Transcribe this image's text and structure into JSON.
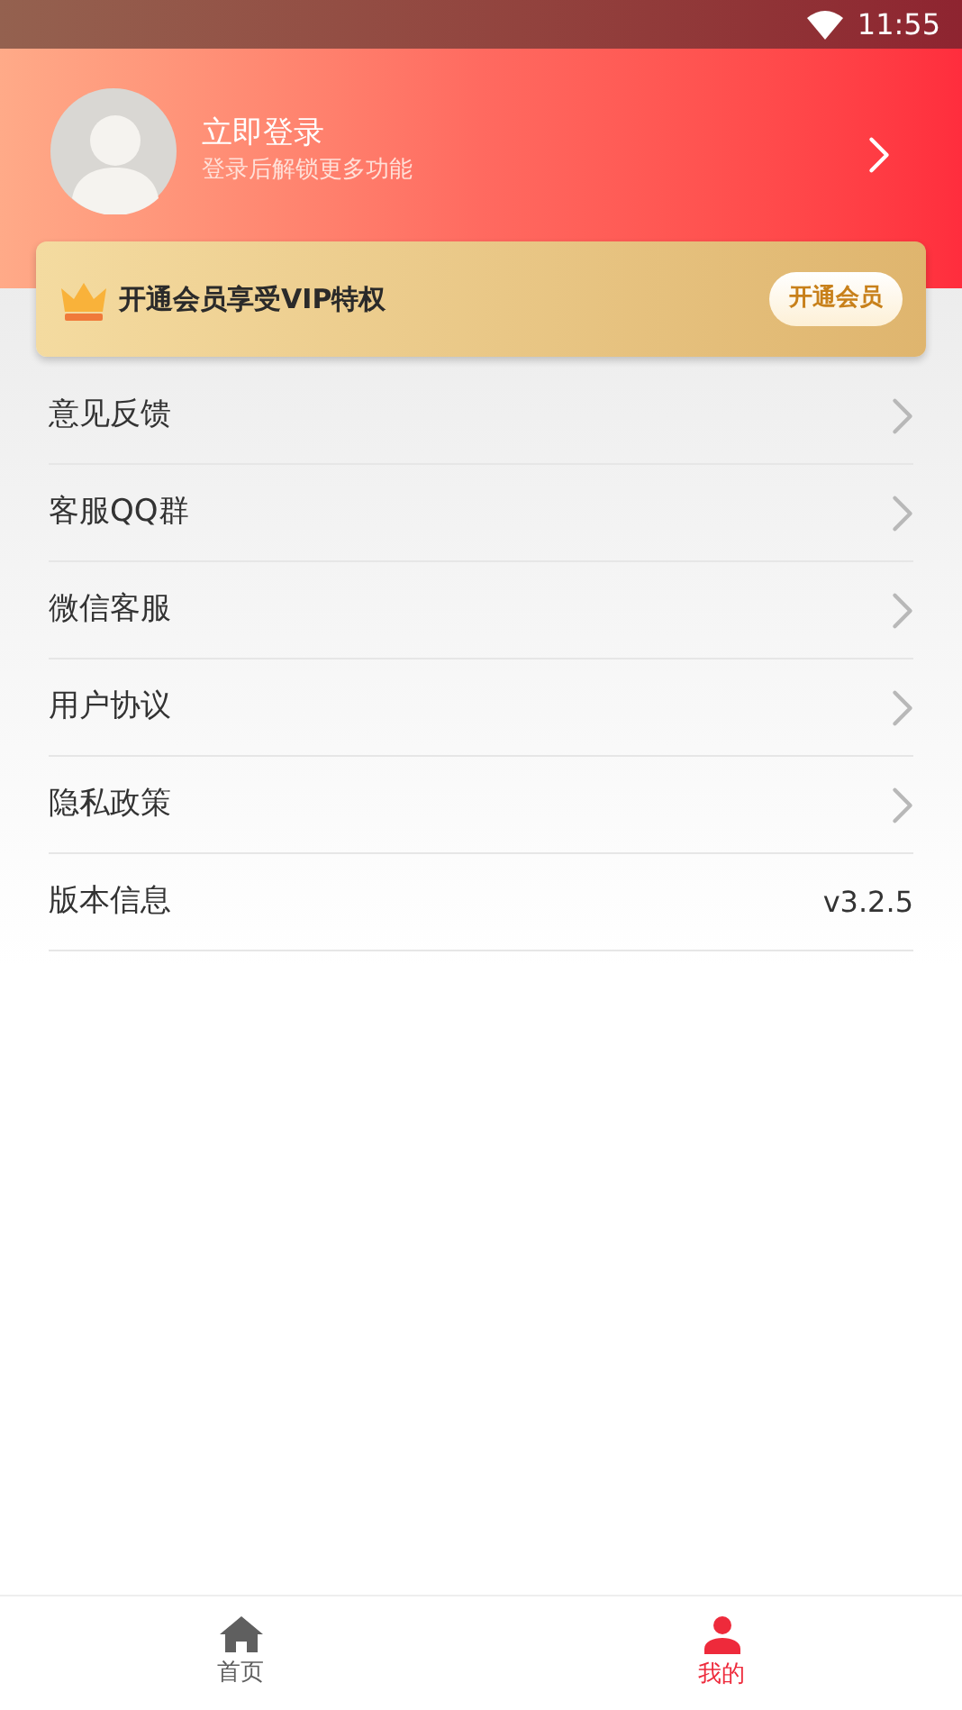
{
  "status_bar": {
    "time": "11:55"
  },
  "profile": {
    "title": "立即登录",
    "subtitle": "登录后解锁更多功能"
  },
  "vip_banner": {
    "text": "开通会员享受VIP特权",
    "button": "开通会员"
  },
  "menu": [
    {
      "label": "意见反馈",
      "kind": "link"
    },
    {
      "label": "客服QQ群",
      "kind": "link"
    },
    {
      "label": "微信客服",
      "kind": "link"
    },
    {
      "label": "用户协议",
      "kind": "link"
    },
    {
      "label": "隐私政策",
      "kind": "link"
    },
    {
      "label": "版本信息",
      "kind": "value",
      "value": "v3.2.5"
    }
  ],
  "tab_bar": [
    {
      "label": "首页",
      "kind": "home",
      "selected": false
    },
    {
      "label": "我的",
      "kind": "person",
      "selected": true
    }
  ]
}
